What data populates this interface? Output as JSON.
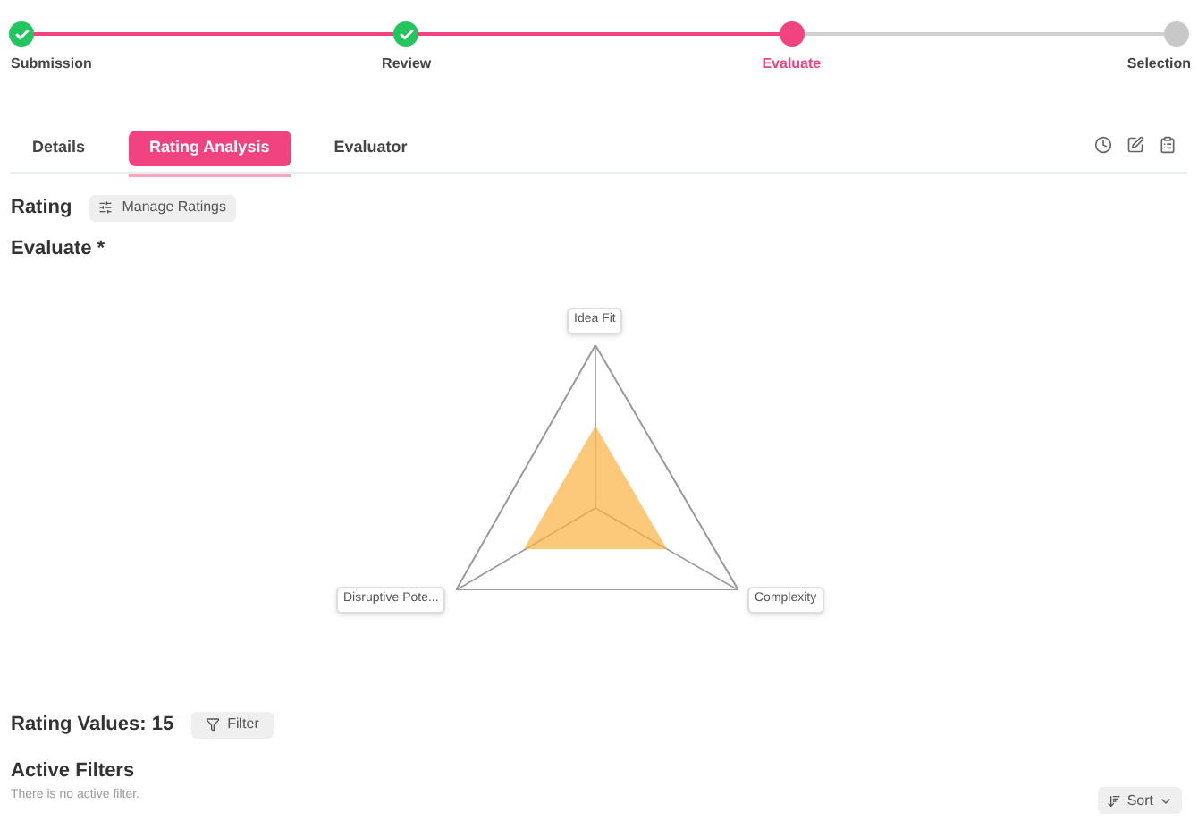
{
  "stepper": [
    {
      "label": "Submission",
      "done": true,
      "selected": false
    },
    {
      "label": "Review",
      "done": true,
      "selected": false
    },
    {
      "label": "Evaluate",
      "done": false,
      "selected": true
    },
    {
      "label": "Selection",
      "done": false,
      "selected": false
    }
  ],
  "tabs": [
    {
      "label": "Details",
      "selected": false
    },
    {
      "label": "Rating Analysis",
      "selected": true
    },
    {
      "label": "Evaluator",
      "selected": false
    }
  ],
  "rating": {
    "title": "Rating",
    "button": "Manage Ratings"
  },
  "evaluate": {
    "title": "Evaluate *",
    "axes": [
      {
        "label": "Idea Fit"
      },
      {
        "label": "Complexity"
      },
      {
        "label": "Disruptive Pote..."
      }
    ]
  },
  "values": {
    "title": "Rating Values: 15",
    "filter_button": "Filter"
  },
  "active_filters": {
    "title": "Active Filters",
    "empty_text": "There is no active filter.",
    "sort_button": "Sort"
  }
}
